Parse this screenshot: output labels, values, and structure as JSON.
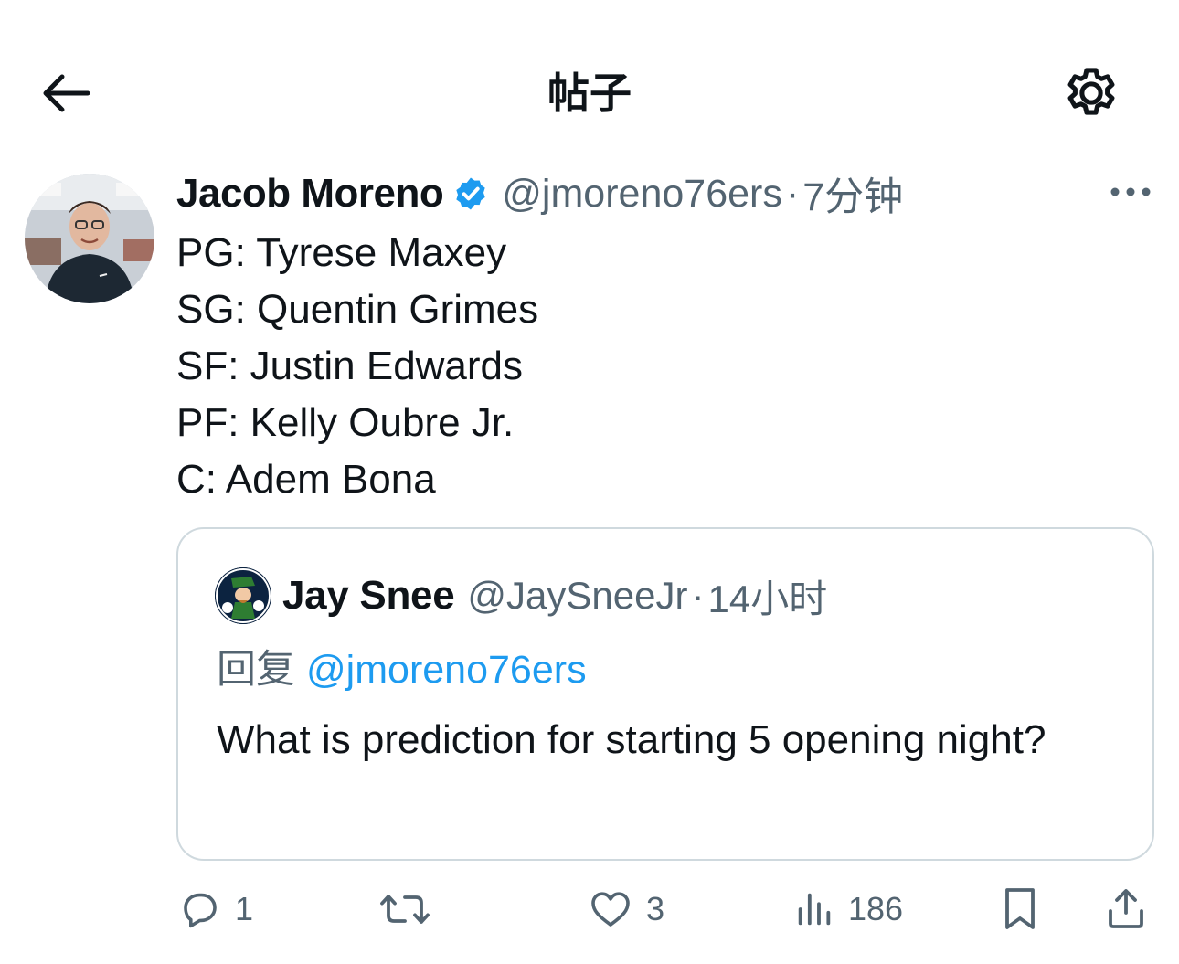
{
  "header": {
    "title": "帖子",
    "back_icon": "arrow-left-icon",
    "settings_icon": "gear-icon"
  },
  "post": {
    "author_name": "Jacob Moreno",
    "verified_icon": "verified-badge-icon",
    "handle": "@jmoreno76ers",
    "separator": "·",
    "time": "7分钟",
    "more_icon": "more-horizontal-icon",
    "lines": [
      "PG: Tyrese Maxey",
      "SG: Quentin Grimes",
      "SF: Justin Edwards",
      "PF: Kelly Oubre Jr.",
      "C: Adem Bona"
    ]
  },
  "quote": {
    "author_name": "Jay Snee",
    "handle": "@JaySneeJr",
    "separator": "·",
    "time": "14小时",
    "reply_prefix": "回复",
    "reply_to": "@jmoreno76ers",
    "text": "What is prediction for starting 5 opening night?"
  },
  "actions": {
    "reply_count": "1",
    "repost_count": "",
    "like_count": "3",
    "views_count": "186"
  },
  "colors": {
    "text_primary": "#0f1419",
    "text_secondary": "#536471",
    "accent": "#1d9bf0",
    "border": "#cfd9de"
  }
}
